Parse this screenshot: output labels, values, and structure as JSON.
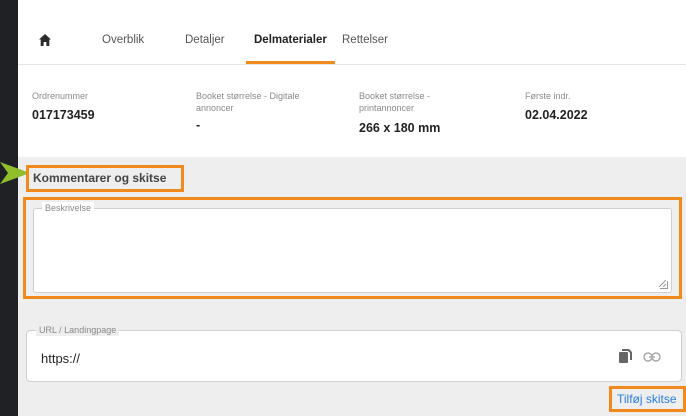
{
  "tabs": {
    "home": "home",
    "items": [
      {
        "label": "Overblik"
      },
      {
        "label": "Detaljer"
      },
      {
        "label": "Delmaterialer",
        "active": true
      },
      {
        "label": "Rettelser"
      }
    ]
  },
  "info": [
    {
      "label": "Ordrenummer",
      "value": "017173459"
    },
    {
      "label": "Booket størrelse - Digitale annoncer",
      "value": "-"
    },
    {
      "label": "Booket størrelse - printannoncer",
      "value": "266 x 180 mm"
    },
    {
      "label": "Første indr.",
      "value": "02.04.2022"
    }
  ],
  "section": {
    "title": "Kommentarer og skitse",
    "description_label": "Beskrivelse",
    "description_value": "",
    "url_label": "URL / Landingpage",
    "url_value": "https://",
    "add_sketch_label": "Tilføj skitse"
  },
  "colors": {
    "accent": "#f08a1c",
    "link": "#2a7de1",
    "arrow": "#8fbf2a"
  }
}
